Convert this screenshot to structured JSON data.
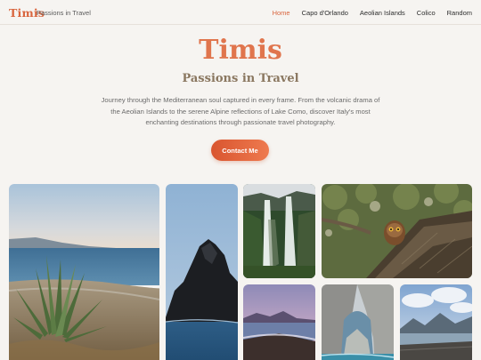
{
  "header": {
    "brand": "Timis",
    "tagline": "Passions in Travel",
    "nav": [
      {
        "label": "Home",
        "active": true
      },
      {
        "label": "Capo d'Orlando",
        "active": false
      },
      {
        "label": "Aeolian Islands",
        "active": false
      },
      {
        "label": "Colico",
        "active": false
      },
      {
        "label": "Random",
        "active": false
      }
    ]
  },
  "hero": {
    "title": "Timis",
    "subtitle": "Passions in Travel",
    "description": "Journey through the Mediterranean soul captured in every frame. From the volcanic drama of the Aeolian Islands to the serene Alpine reflections of Lake Como, discover Italy's most enchanting destinations through passionate travel photography.",
    "cta_label": "Contact Me"
  },
  "colors": {
    "accent": "#d9663f",
    "title": "#e0754d",
    "subtitle": "#8a7760",
    "background": "#f6f4f1"
  }
}
